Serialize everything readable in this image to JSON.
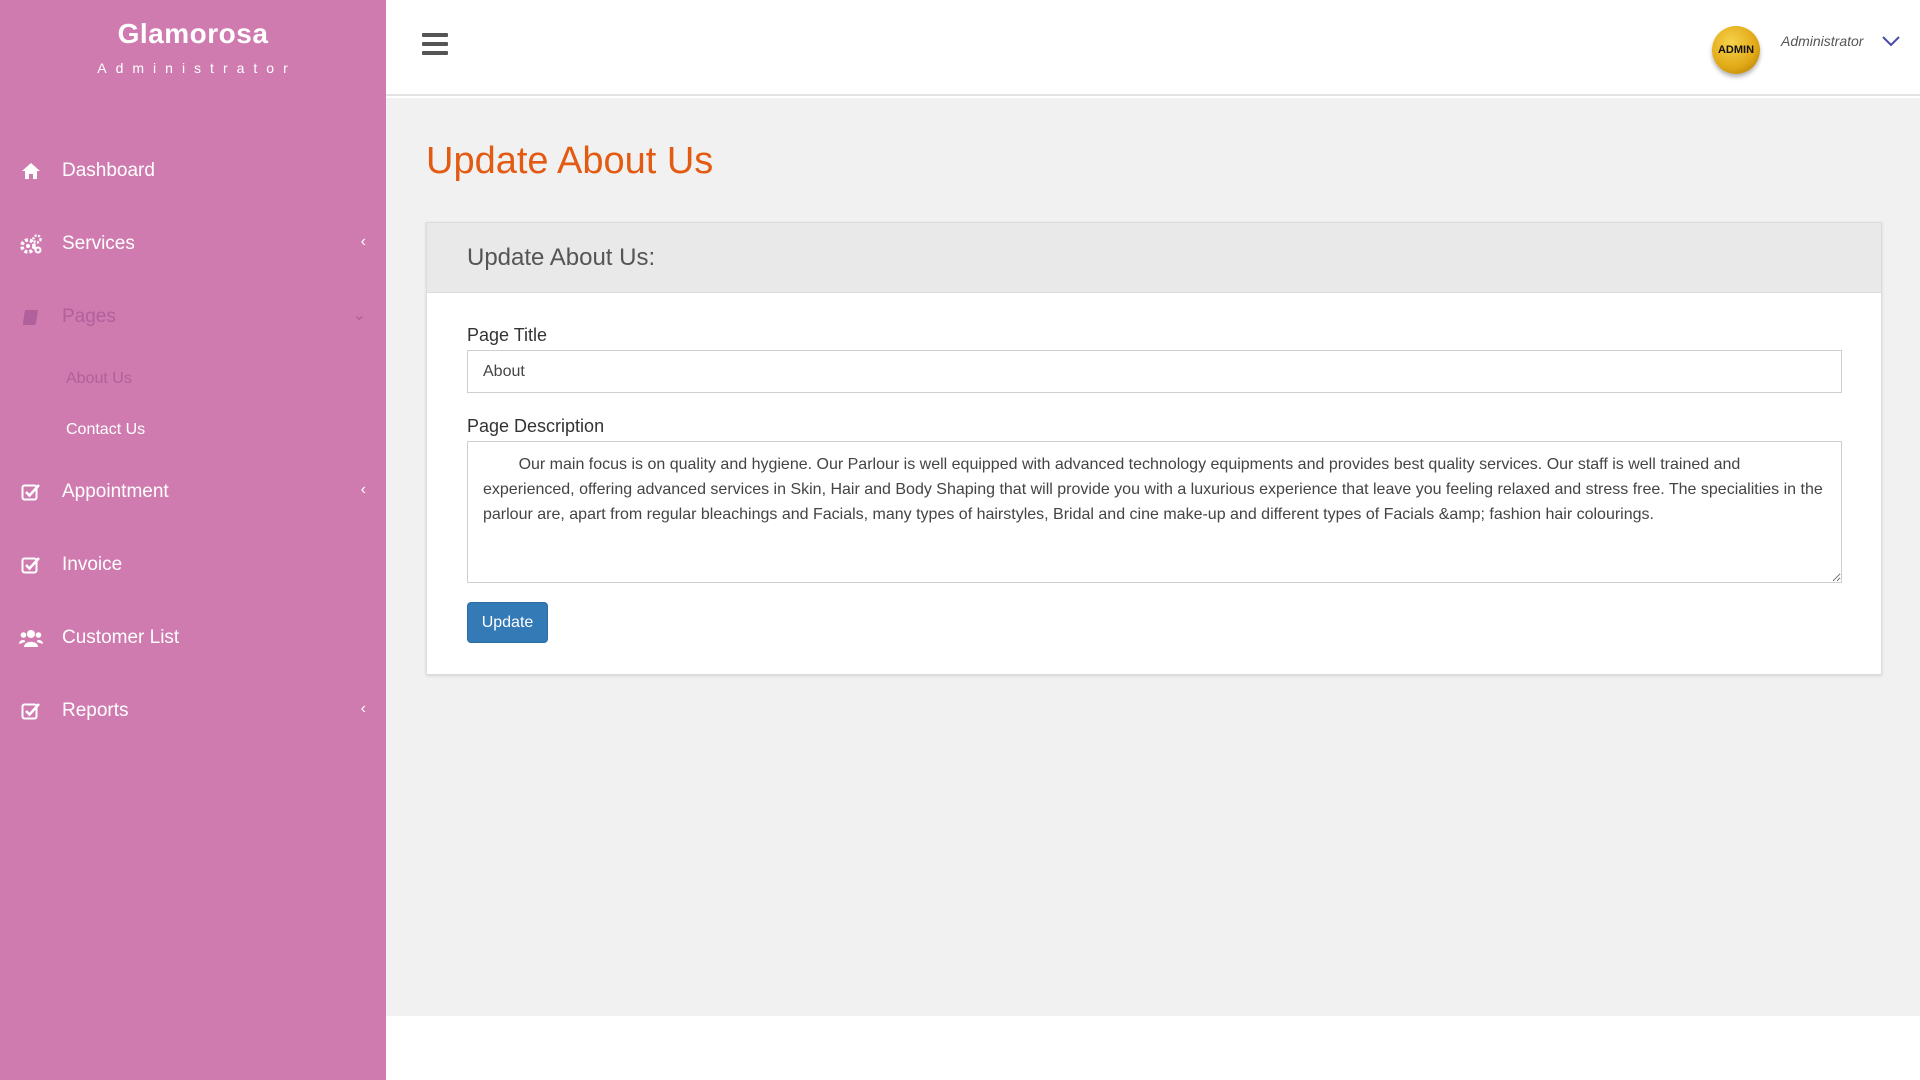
{
  "brand": {
    "name": "Glamorosa",
    "subtitle": "Administrator"
  },
  "sidebar": {
    "items": [
      {
        "label": "Dashboard",
        "icon": "home-icon"
      },
      {
        "label": "Services",
        "icon": "cogs-icon",
        "chevron": "‹"
      },
      {
        "label": "Pages",
        "icon": "book-icon",
        "chevron": "⌄"
      },
      {
        "label": "Appointment",
        "icon": "check-square-icon",
        "chevron": "‹"
      },
      {
        "label": "Invoice",
        "icon": "check-square-icon"
      },
      {
        "label": "Customer List",
        "icon": "users-icon"
      },
      {
        "label": "Reports",
        "icon": "check-square-icon",
        "chevron": "‹"
      }
    ],
    "pages_submenu": [
      {
        "label": "About Us"
      },
      {
        "label": "Contact Us"
      }
    ]
  },
  "topbar": {
    "avatar_text": "ADMIN",
    "user_name": "Administrator"
  },
  "main": {
    "page_title": "Update About Us",
    "card_title": "Update About Us:",
    "form": {
      "title_label": "Page Title",
      "title_value": "About",
      "description_label": "Page Description",
      "description_value": "        Our main focus is on quality and hygiene. Our Parlour is well equipped with advanced technology equipments and provides best quality services. Our staff is well trained and experienced, offering advanced services in Skin, Hair and Body Shaping that will provide you with a luxurious experience that leave you feeling relaxed and stress free. The specialities in the parlour are, apart from regular bleachings and Facials, many types of hairstyles, Bridal and cine make-up and different types of Facials &amp; fashion hair colourings.",
      "submit_label": "Update"
    }
  },
  "colors": {
    "sidebar_bg": "#d07bb0",
    "accent_title": "#e35b12",
    "button_primary": "#337ab7"
  }
}
